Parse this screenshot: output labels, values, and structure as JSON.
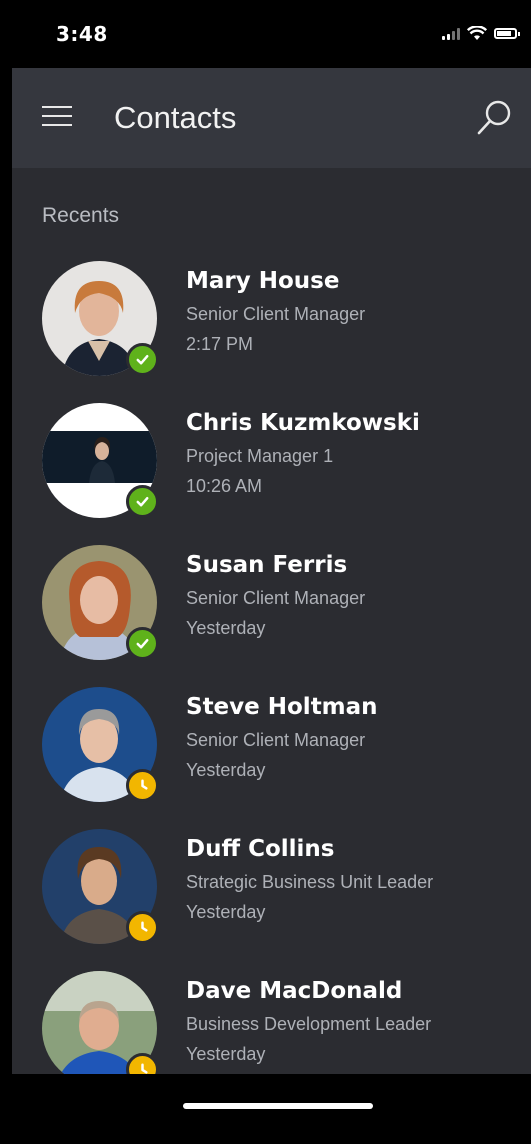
{
  "status_bar": {
    "time": "3:48"
  },
  "header": {
    "title": "Contacts",
    "menu_icon": "hamburger-icon",
    "search_icon": "search-icon"
  },
  "recents": {
    "section_label": "Recents",
    "contacts": [
      {
        "name": "Mary House",
        "role": "Senior Client Manager",
        "time": "2:17 PM",
        "presence": "available"
      },
      {
        "name": "Chris Kuzmkowski",
        "role": "Project Manager 1",
        "time": "10:26 AM",
        "presence": "available"
      },
      {
        "name": "Susan Ferris",
        "role": "Senior Client Manager",
        "time": "Yesterday",
        "presence": "available"
      },
      {
        "name": "Steve Holtman",
        "role": "Senior Client Manager",
        "time": "Yesterday",
        "presence": "away"
      },
      {
        "name": "Duff Collins",
        "role": "Strategic Business Unit Leader",
        "time": "Yesterday",
        "presence": "away"
      },
      {
        "name": "Dave MacDonald",
        "role": "Business Development Leader",
        "time": "Yesterday",
        "presence": "away"
      }
    ]
  },
  "colors": {
    "available": "#5fb21b",
    "away": "#f2b600",
    "background": "#2b2c31",
    "header": "#35373e"
  }
}
